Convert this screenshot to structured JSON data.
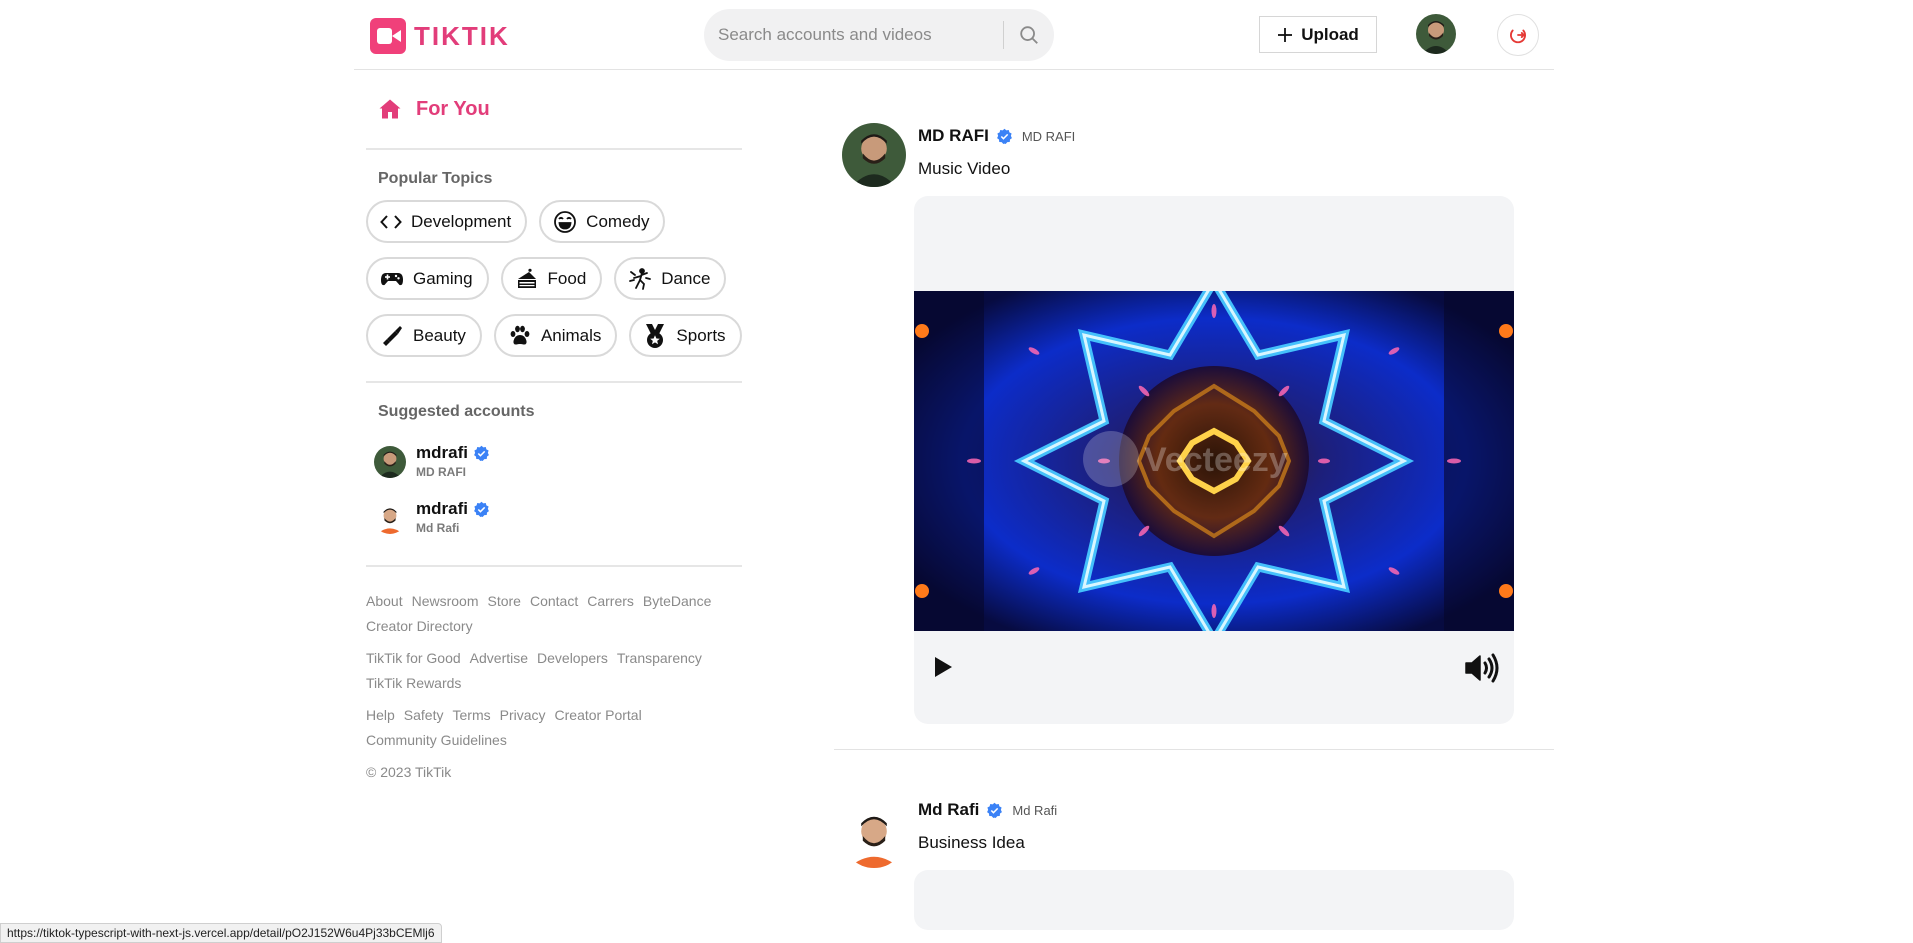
{
  "header": {
    "logo_text": "TIKTIK",
    "search_placeholder": "Search accounts and videos",
    "upload_label": "Upload"
  },
  "sidebar": {
    "for_you_label": "For You",
    "popular_topics_title": "Popular Topics",
    "topics": [
      {
        "label": "Development",
        "icon": "code-icon"
      },
      {
        "label": "Comedy",
        "icon": "laughing-face-icon"
      },
      {
        "label": "Gaming",
        "icon": "gamepad-icon"
      },
      {
        "label": "Food",
        "icon": "cake-icon"
      },
      {
        "label": "Dance",
        "icon": "dancer-icon"
      },
      {
        "label": "Beauty",
        "icon": "lipstick-icon"
      },
      {
        "label": "Animals",
        "icon": "paw-icon"
      },
      {
        "label": "Sports",
        "icon": "medal-icon"
      }
    ],
    "suggested_title": "Suggested accounts",
    "accounts": [
      {
        "name": "mdrafi",
        "sub": "MD RAFI"
      },
      {
        "name": "mdrafi",
        "sub": "Md Rafi"
      }
    ],
    "footer": {
      "group1": [
        "About",
        "Newsroom",
        "Store",
        "Contact",
        "Carrers",
        "ByteDance",
        "Creator Directory"
      ],
      "group2": [
        "TikTik for Good",
        "Advertise",
        "Developers",
        "Transparency",
        "TikTik Rewards"
      ],
      "group3": [
        "Help",
        "Safety",
        "Terms",
        "Privacy",
        "Creator Portal",
        "Community Guidelines"
      ],
      "copyright": "© 2023 TikTik"
    }
  },
  "feed": {
    "posts": [
      {
        "username": "MD RAFI",
        "handle": "MD RAFI",
        "caption": "Music Video",
        "watermark": "Vecteezy"
      },
      {
        "username": "Md Rafi",
        "handle": "Md Rafi",
        "caption": "Business Idea"
      }
    ]
  },
  "status_url": "https://tiktok-typescript-with-next-js.vercel.app/detail/pO2J152W6u4Pj33bCEMlj6",
  "colors": {
    "brand": "#e23d7a",
    "verified": "#3b82f6"
  }
}
